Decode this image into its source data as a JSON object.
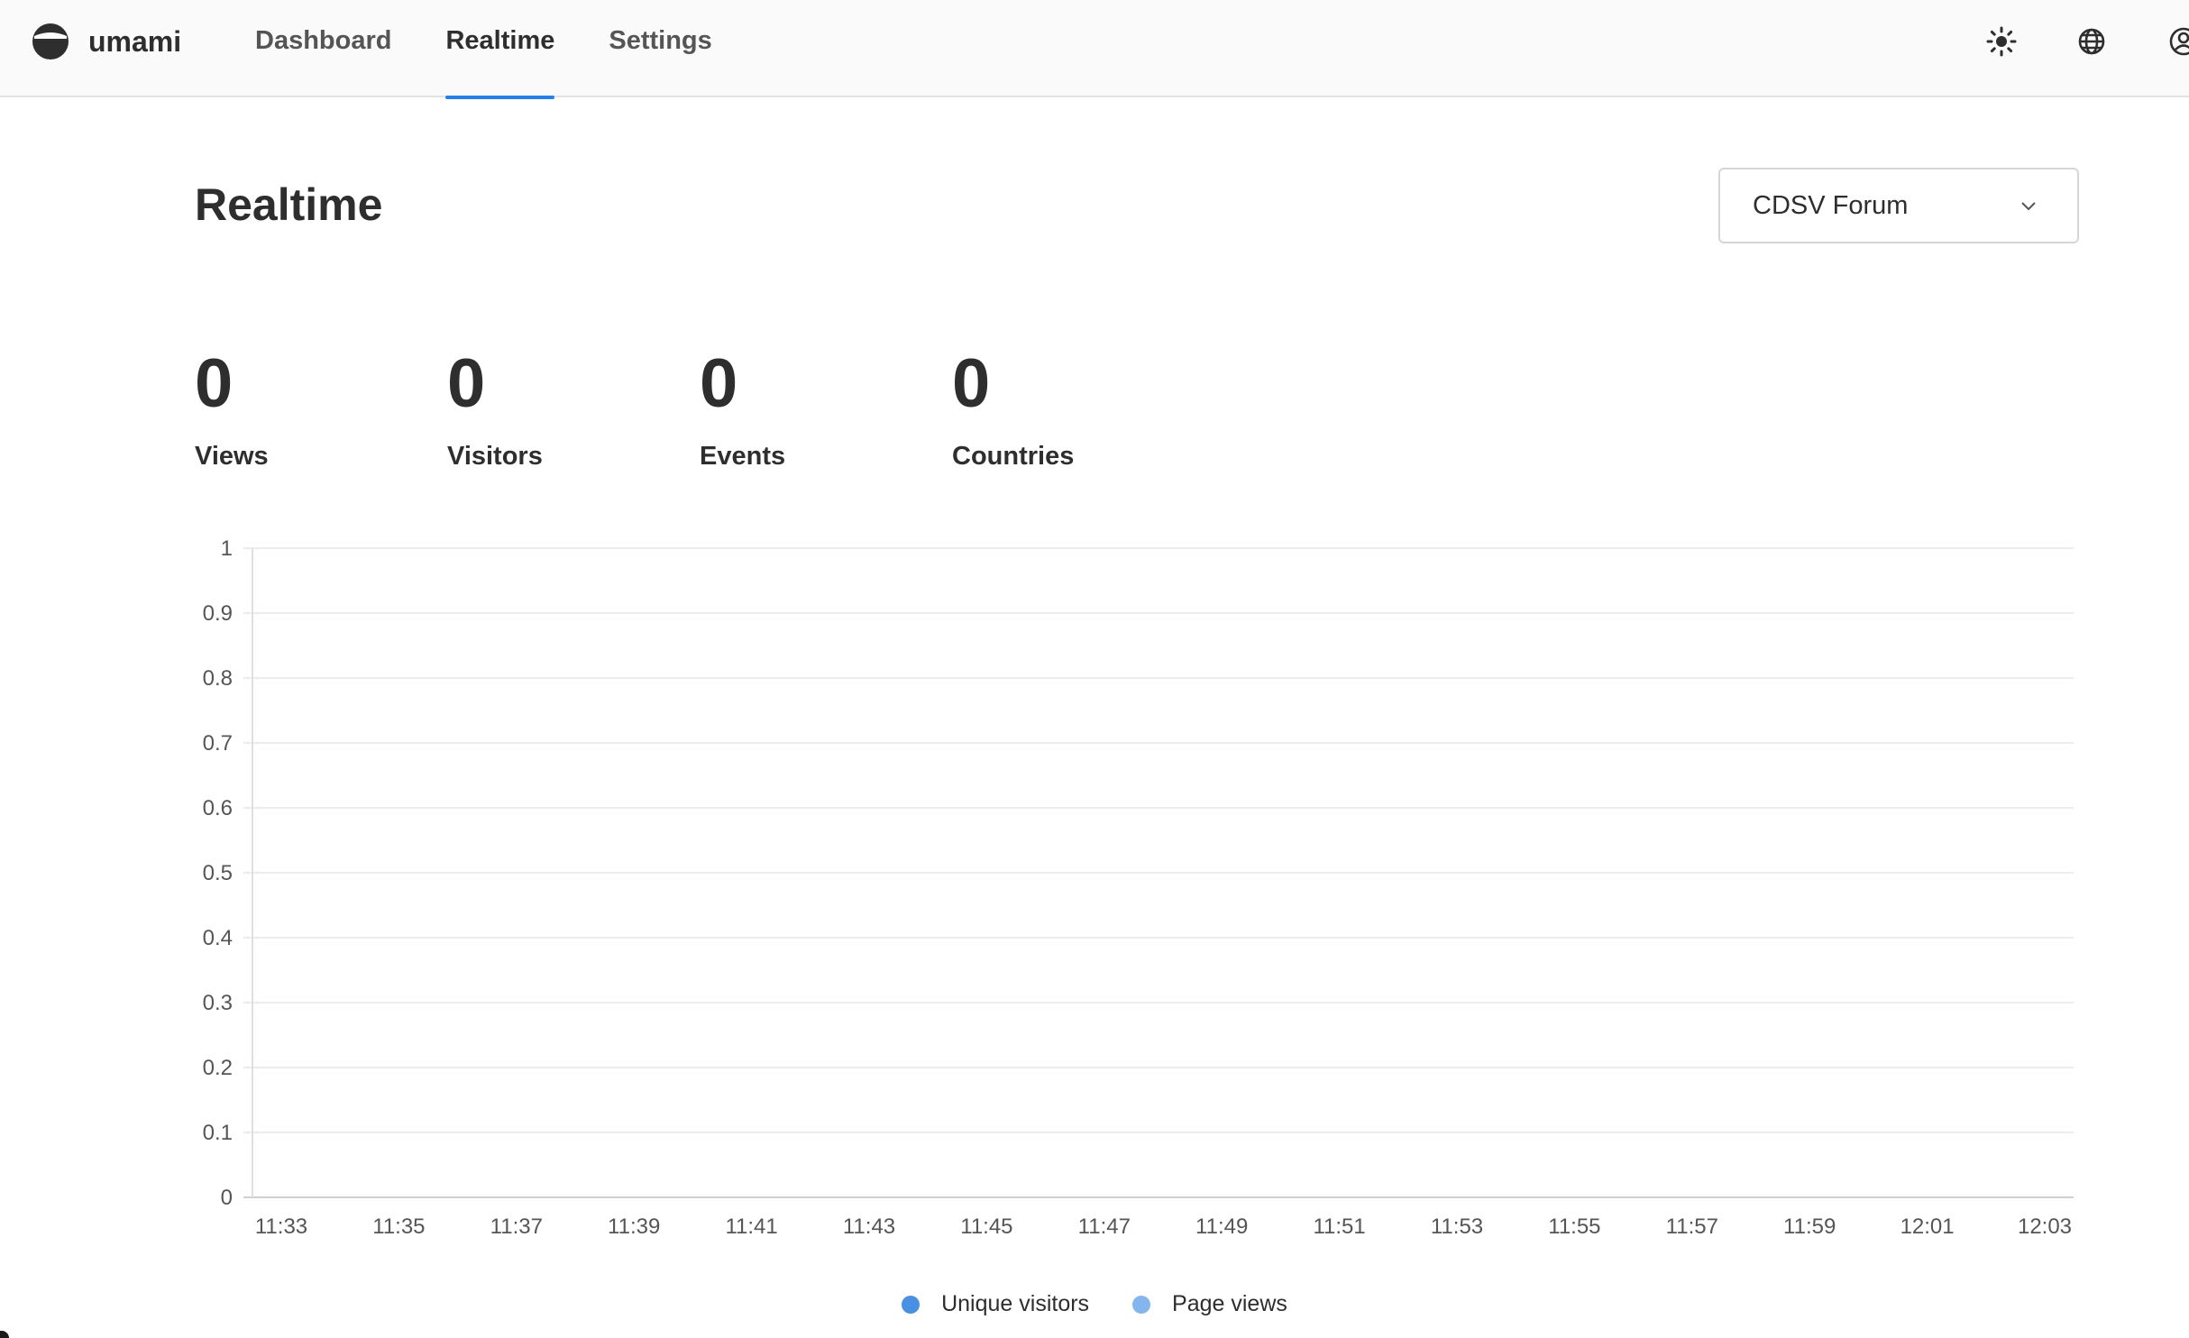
{
  "app": {
    "name": "umami"
  },
  "nav": {
    "items": [
      {
        "label": "Dashboard"
      },
      {
        "label": "Realtime"
      },
      {
        "label": "Settings"
      }
    ],
    "active": "Realtime"
  },
  "header_icons": [
    "sun-icon",
    "globe-icon",
    "user-icon"
  ],
  "page": {
    "title": "Realtime"
  },
  "website_select": {
    "value": "CDSV Forum"
  },
  "metrics": [
    {
      "value": "0",
      "label": "Views"
    },
    {
      "value": "0",
      "label": "Visitors"
    },
    {
      "value": "0",
      "label": "Events"
    },
    {
      "value": "0",
      "label": "Countries"
    }
  ],
  "colors": {
    "accent": "#2680eb",
    "unique_visitors": "#4a90e2",
    "page_views": "#84b5ef"
  },
  "chart_data": {
    "type": "bar",
    "categories": [
      "11:33",
      "11:35",
      "11:37",
      "11:39",
      "11:41",
      "11:43",
      "11:45",
      "11:47",
      "11:49",
      "11:51",
      "11:53",
      "11:55",
      "11:57",
      "11:59",
      "12:01",
      "12:03"
    ],
    "y_ticks": [
      "0",
      "0.1",
      "0.2",
      "0.3",
      "0.4",
      "0.5",
      "0.6",
      "0.7",
      "0.8",
      "0.9",
      "1"
    ],
    "ylim": [
      0,
      1
    ],
    "grid": true,
    "legend_position": "bottom",
    "series": [
      {
        "name": "Unique visitors",
        "values": [
          0,
          0,
          0,
          0,
          0,
          0,
          0,
          0,
          0,
          0,
          0,
          0,
          0,
          0,
          0,
          0
        ]
      },
      {
        "name": "Page views",
        "values": [
          0,
          0,
          0,
          0,
          0,
          0,
          0,
          0,
          0,
          0,
          0,
          0,
          0,
          0,
          0,
          0
        ]
      }
    ]
  }
}
